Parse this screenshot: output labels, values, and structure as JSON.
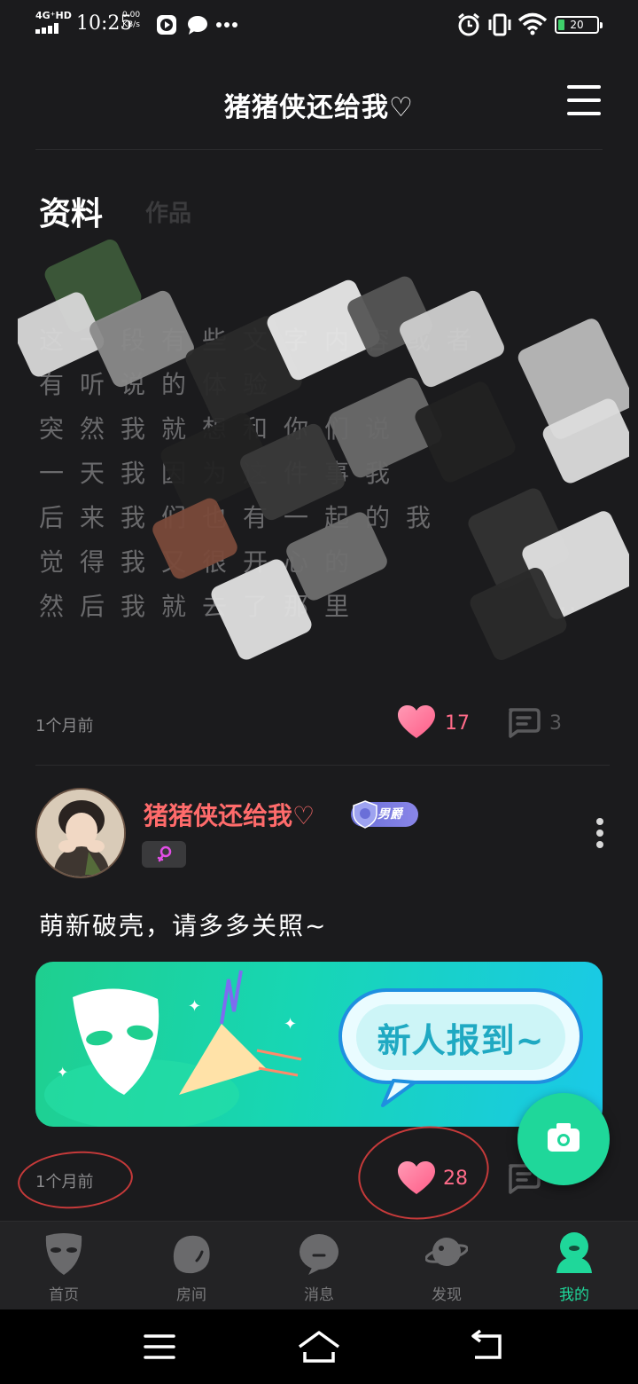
{
  "status_bar": {
    "network": "4G⁺HD",
    "time": "10:25",
    "speed_value": "0.00",
    "speed_unit": "KB/s",
    "battery": "20",
    "icons": [
      "play-icon",
      "chat-bubble-icon",
      "more-dots-icon",
      "alarm-icon",
      "vibrate-icon",
      "wifi-icon",
      "battery-icon"
    ]
  },
  "header": {
    "title": "猪猪侠还给我♡",
    "menu_icon": "hamburger-menu-icon"
  },
  "tabs": [
    {
      "label": "资料",
      "active": true
    },
    {
      "label": "作品",
      "active": false
    }
  ],
  "posts": [
    {
      "content": "已被涂抹遮挡",
      "time": "1个月前",
      "likes": "17",
      "comments": "3"
    },
    {
      "author": "猪猪侠还给我♡",
      "badge": "男爵",
      "gender": "female",
      "text": "萌新破壳，请多多关照~",
      "banner_text": "新人报到~",
      "time": "1个月前",
      "likes": "28"
    }
  ],
  "fab": {
    "icon": "camera-icon"
  },
  "bottom_nav": [
    {
      "label": "首页",
      "icon": "mask-icon",
      "active": false
    },
    {
      "label": "房间",
      "icon": "room-blob-icon",
      "active": false
    },
    {
      "label": "消息",
      "icon": "message-blob-icon",
      "active": false
    },
    {
      "label": "发现",
      "icon": "planet-icon",
      "active": false
    },
    {
      "label": "我的",
      "icon": "profile-blob-icon",
      "active": true
    }
  ],
  "colors": {
    "background": "#1b1b1d",
    "accent": "#1fd79a",
    "like": "#ff6b89",
    "username": "#ff6b6b"
  }
}
